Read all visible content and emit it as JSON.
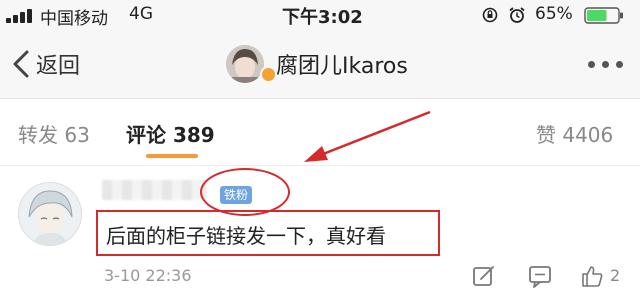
{
  "status_bar": {
    "carrier": "中国移动",
    "network": "4G",
    "time": "下午3:02",
    "battery_percent": "65%",
    "battery_level": 0.65,
    "icons": [
      "signal-icon",
      "rotation-lock-icon",
      "alarm-icon",
      "battery-icon"
    ]
  },
  "nav": {
    "back_label": "返回",
    "title": "腐团儿Ikaros",
    "icons": [
      "back-chevron-icon",
      "avatar",
      "more-icon"
    ]
  },
  "tabs": {
    "repost": "转发 63",
    "comment": "评论 389",
    "like": "赞 4406"
  },
  "comment": {
    "badge": "铁粉",
    "text": "后面的柜子链接发一下，真好看",
    "time": "3-10 22:36",
    "like_count": "2",
    "icons": [
      "edit-icon",
      "comment-icon",
      "thumbs-up-icon"
    ]
  },
  "colors": {
    "accent": "#f49a3b",
    "badge": "#6fa4e0",
    "annotation_red": "#d52a2a",
    "battery_green": "#4cd964"
  }
}
